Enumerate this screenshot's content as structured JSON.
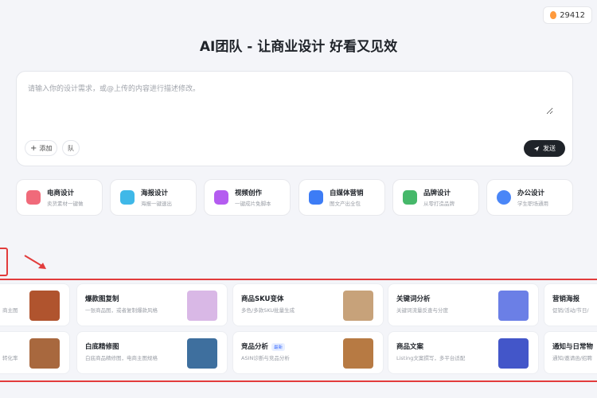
{
  "credit": {
    "value": "29412"
  },
  "title": "AI团队 - 让商业设计 好看又见效",
  "prompt": {
    "placeholder": "请输入你的设计需求，或@上传的内容进行描述修改。",
    "add_label": "添加",
    "mention_label": "队",
    "send_label": "发送"
  },
  "categories": [
    {
      "title": "电商设计",
      "sub": "卖货素材一键做",
      "color": "#f06a7a"
    },
    {
      "title": "海报设计",
      "sub": "海报一键速出",
      "color": "#3fb8e8"
    },
    {
      "title": "视频创作",
      "sub": "一键成片免脚本",
      "color": "#b45cf0"
    },
    {
      "title": "自媒体营销",
      "sub": "图文产出全包",
      "color": "#3d7cf5"
    },
    {
      "title": "品牌设计",
      "sub": "从零打造品牌",
      "color": "#46b86a"
    },
    {
      "title": "办公设计",
      "sub": "学生职场通用",
      "color": "#4a86f7"
    }
  ],
  "tools_row1": [
    {
      "title": "",
      "sub": "商主图",
      "thumb": "#b0542e"
    },
    {
      "title": "爆款图复制",
      "sub": "一张商品图，或者复制爆款风格",
      "thumb": "#d9b8e6"
    },
    {
      "title": "商品SKU变体",
      "sub": "多色/多款SKU批量生成",
      "thumb": "#c7a27a"
    },
    {
      "title": "关键词分析",
      "sub": "关键词流量反查与分度",
      "thumb": "#6b7fe6"
    },
    {
      "title": "营销海报",
      "sub": "促销/活动/节日/",
      "thumb": "#ffffff"
    }
  ],
  "tools_row2": [
    {
      "title": "",
      "sub": "转化率",
      "thumb": "#a8683e"
    },
    {
      "title": "白底精修图",
      "sub": "白底商品精修图，电商主图规格",
      "thumb": "#3e6f9e"
    },
    {
      "title": "竞品分析",
      "badge": "最新",
      "sub": "ASIN诊断与竞品分析",
      "thumb": "#b77a43"
    },
    {
      "title": "商品文案",
      "sub": "Listing文案撰写，多平台适配",
      "thumb": "#4356c9"
    },
    {
      "title": "通知与日常物",
      "sub": "通知/邀请函/招聘",
      "thumb": "#ffffff"
    }
  ]
}
